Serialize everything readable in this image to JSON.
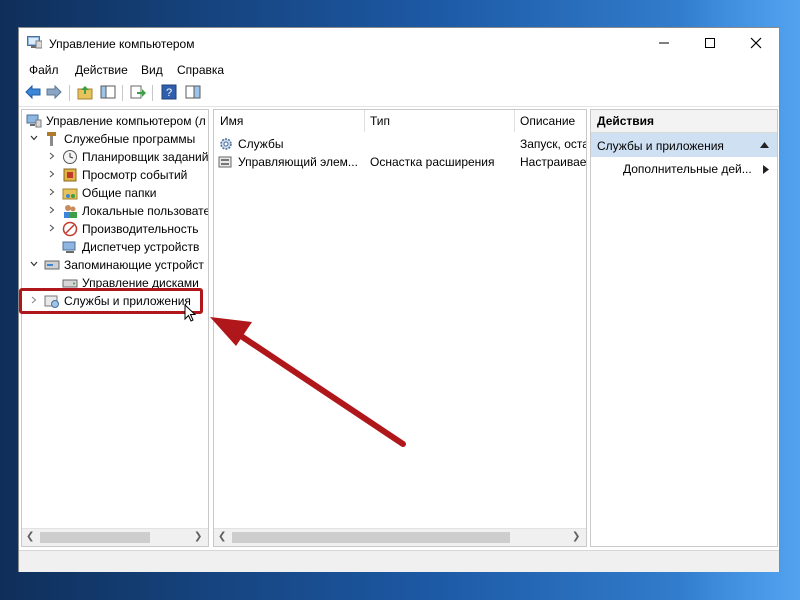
{
  "window": {
    "title": "Управление компьютером"
  },
  "menu": [
    "Файл",
    "Действие",
    "Вид",
    "Справка"
  ],
  "tree": {
    "root": "Управление компьютером (л",
    "items": [
      {
        "label": "Служебные программы",
        "level": 1,
        "expander": "expanded"
      },
      {
        "label": "Планировщик заданий",
        "level": 2,
        "expander": "collapsed"
      },
      {
        "label": "Просмотр событий",
        "level": 2,
        "expander": "collapsed"
      },
      {
        "label": "Общие папки",
        "level": 2,
        "expander": "collapsed"
      },
      {
        "label": "Локальные пользовате",
        "level": 2,
        "expander": "collapsed"
      },
      {
        "label": "Производительность",
        "level": 2,
        "expander": "collapsed"
      },
      {
        "label": "Диспетчер устройств",
        "level": 2,
        "expander": "none"
      },
      {
        "label": "Запоминающие устройст",
        "level": 1,
        "expander": "expanded"
      },
      {
        "label": "Управление дисками",
        "level": 2,
        "expander": "none"
      },
      {
        "label": "Службы и приложения",
        "level": 1,
        "expander": "collapsed",
        "selected": true
      }
    ]
  },
  "list": {
    "columns": [
      "Имя",
      "Тип",
      "Описание"
    ],
    "rows": [
      {
        "name": "Службы",
        "type": "",
        "description": "Запуск, оста"
      },
      {
        "name": "Управляющий элем...",
        "type": "Оснастка расширения",
        "description": "Настраивае"
      }
    ]
  },
  "actions": {
    "header": "Действия",
    "section": "Службы и приложения",
    "item": "Дополнительные дей..."
  },
  "colors": {
    "highlight": "#b0171b",
    "section_bg": "#cfe0f2",
    "arrow": "#b0171b"
  }
}
